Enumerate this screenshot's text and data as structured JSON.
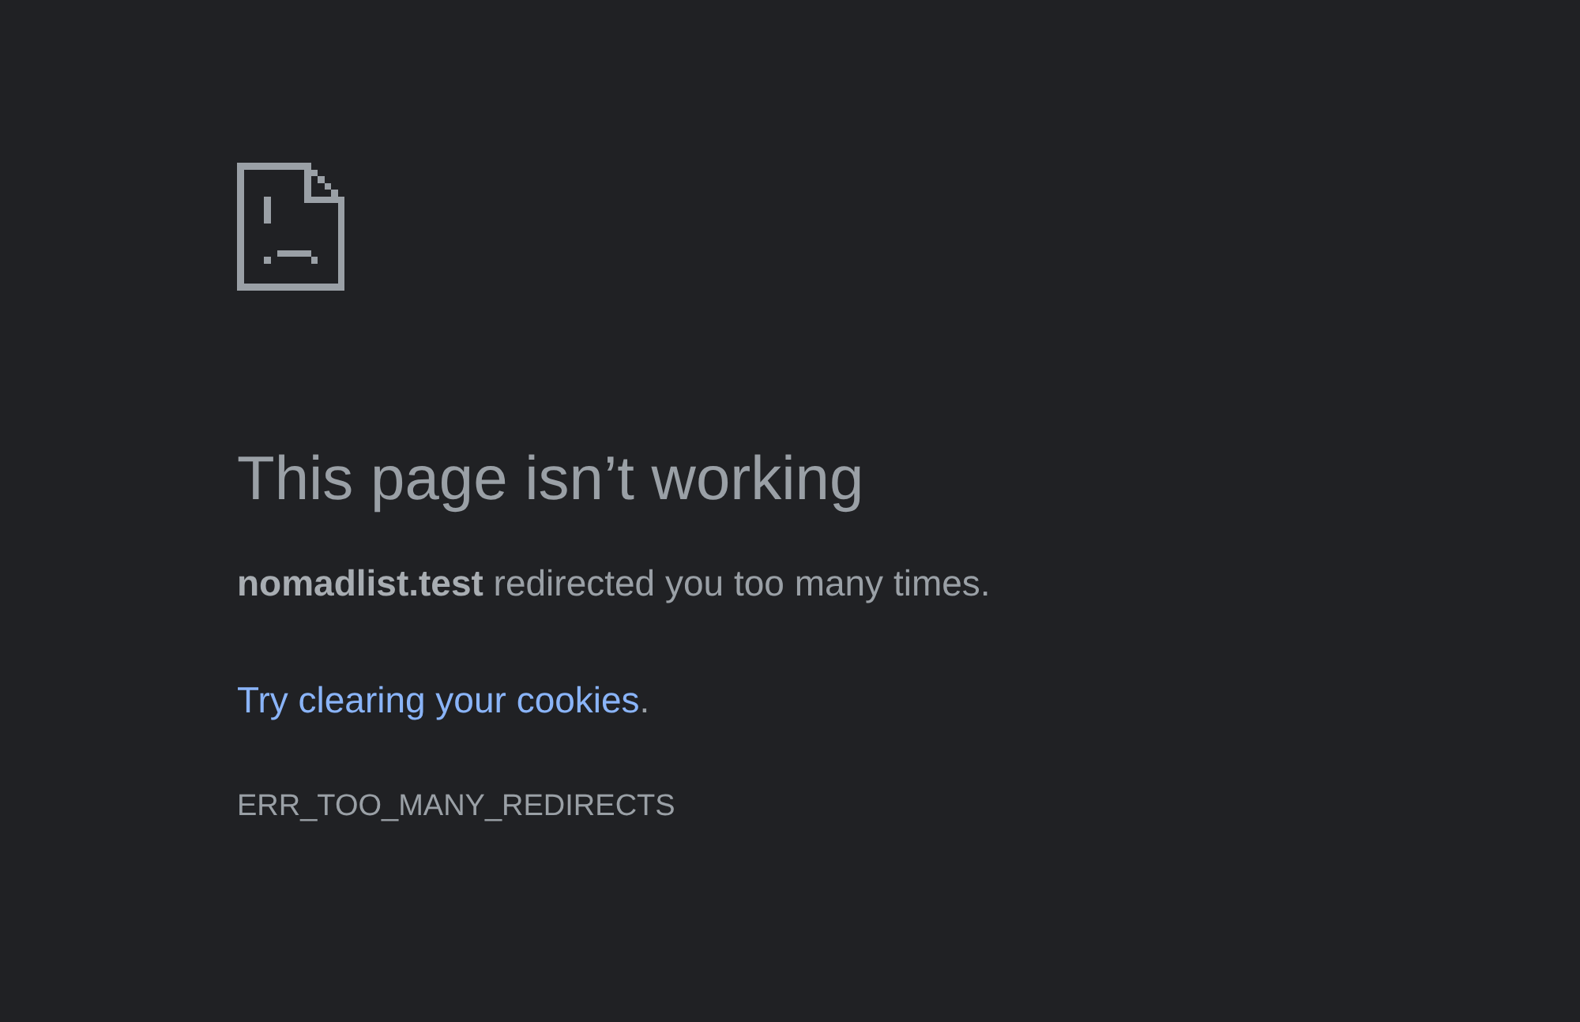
{
  "heading": "This page isn’t working",
  "message": "**nomadlist.test** redirected you too many times.",
  "suggestion": {
    "link": "Try clearing your cookies",
    "text_after": "."
  },
  "error_code": "ERR_TOO_MANY_REDIRECTS"
}
